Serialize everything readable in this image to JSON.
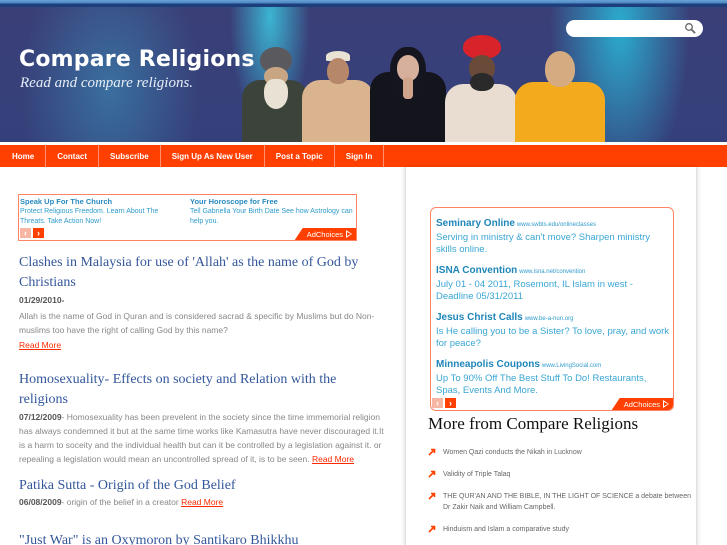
{
  "header": {
    "site_title": "Compare Religions",
    "tagline": "Read and compare religions.",
    "search": {
      "placeholder": "",
      "value": "",
      "icon": "search-icon"
    }
  },
  "nav": {
    "items": [
      {
        "label": "Home"
      },
      {
        "label": "Contact"
      },
      {
        "label": "Subscribe"
      },
      {
        "label": "Sign Up As New User"
      },
      {
        "label": "Post a Topic"
      },
      {
        "label": "Sign In"
      }
    ],
    "color": "#ff4000"
  },
  "top_ad": {
    "ads": [
      {
        "title": "Speak Up For The Church",
        "text": "Protect Religious Freedom. Learn About The Threats. Take Action Now!"
      },
      {
        "title": "Your Horoscope for Free",
        "text": "Tell Gabriella Your Birth Date See how Astrology can help you."
      }
    ],
    "prev": "‹",
    "next": "›",
    "adchoices": "AdChoices"
  },
  "articles": [
    {
      "title": "Clashes in Malaysia for use of 'Allah' as the name of God by Christians",
      "date": "01/29/2010-",
      "excerpt": "Allah is the name of God in Quran and is considered sacrad & specific by Muslims but do Non-muslims too have the right of calling God by this name?",
      "read_more": "Read More"
    },
    {
      "title": "Homosexuality- Effects on society and Relation with the religions",
      "date": "07/12/2009",
      "excerpt": "- Homosexuality has been prevelent in the society since the time immemorial religion has always condemned it but at the same time works like Kamasutra have never discouraged it.It is a harm to soceity and the individual health but can it be controlled by a legislation against it. or repealing a legislation would mean an uncontrolled spread of it, is to be seen. ",
      "read_more": "Read More"
    },
    {
      "title": "Patika Sutta - Origin of the God Belief",
      "date": "06/08/2009",
      "excerpt": "- origin of the belief in a creator ",
      "read_more": "Read More"
    },
    {
      "title": "\"Just War\" is an Oxymoron by Santikaro Bhikkhu"
    }
  ],
  "side_ad": {
    "ads": [
      {
        "title": "Seminary Online",
        "url": "www.swbts.edu/onlineclasses",
        "text": "Serving in ministry & can't move? Sharpen ministry skills online."
      },
      {
        "title": "ISNA Convention",
        "url": "www.isna.net/convention",
        "text": "July 01 - 04 2011, Rosemont, IL Islam in west - Deadline 05/31/2011"
      },
      {
        "title": "Jesus Christ Calls",
        "url": "www.be-a-nun.org",
        "text": "Is He calling you to be a Sister? To love, pray, and work for peace?"
      },
      {
        "title": "Minneapolis Coupons",
        "url": "www.LivingSocial.com",
        "text": "Up To 90% Off The Best Stuff To Do! Restaurants, Spas, Events And More."
      }
    ],
    "prev": "‹",
    "next": "›",
    "adchoices": "AdChoices"
  },
  "more": {
    "title": "More from Compare Religions",
    "items": [
      {
        "label": "Women Qazi conducts the Nikah in Lucknow"
      },
      {
        "label": "Validity of Triple Talaq"
      },
      {
        "label": "THE QUR'AN AND THE BIBLE, IN THE LIGHT OF SCIENCE a debate between Dr Zakir Naik and William Campbell."
      },
      {
        "label": "Hinduism and Islam a comparative study"
      }
    ]
  }
}
